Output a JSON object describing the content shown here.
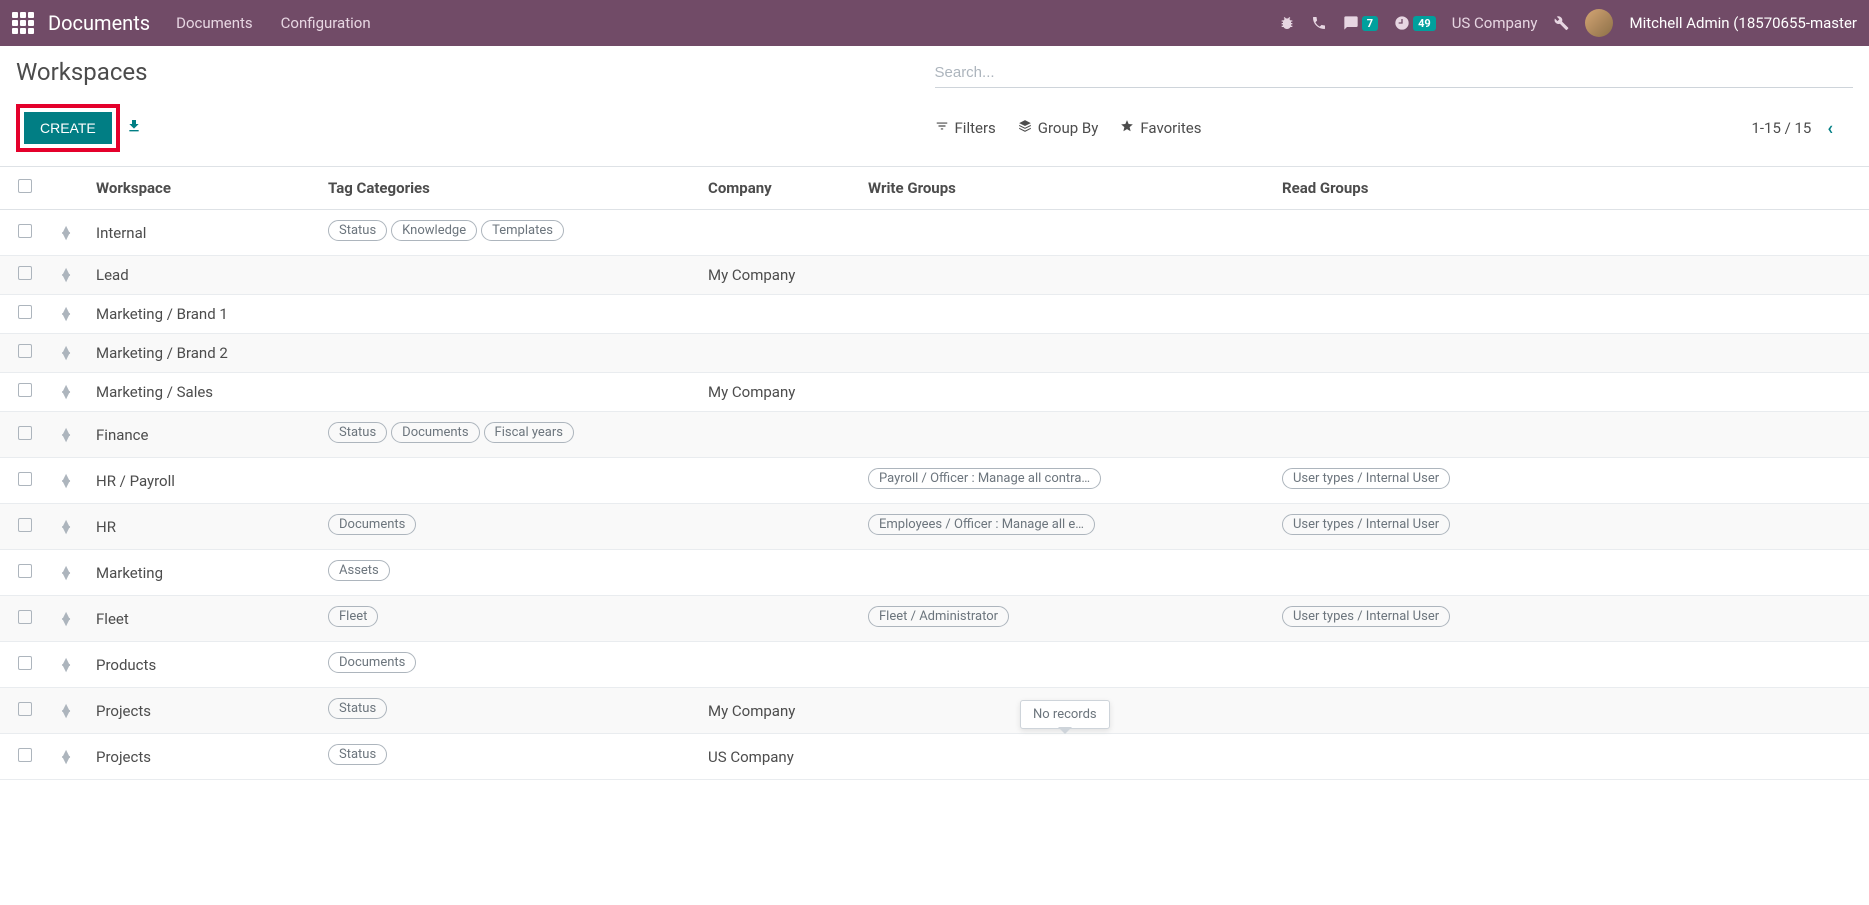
{
  "nav": {
    "app_title": "Documents",
    "links": [
      "Documents",
      "Configuration"
    ],
    "badges": {
      "messages": "7",
      "activities": "49"
    },
    "company": "US Company",
    "user": "Mitchell Admin (18570655-master"
  },
  "page": {
    "title": "Workspaces",
    "search_placeholder": "Search...",
    "create_label": "CREATE",
    "filters_label": "Filters",
    "groupby_label": "Group By",
    "favorites_label": "Favorites",
    "pager": "1-15 / 15"
  },
  "columns": {
    "workspace": "Workspace",
    "tags": "Tag Categories",
    "company": "Company",
    "write": "Write Groups",
    "read": "Read Groups"
  },
  "rows": [
    {
      "workspace": "Internal",
      "tags": [
        "Status",
        "Knowledge",
        "Templates"
      ],
      "company": "",
      "write": [],
      "read": []
    },
    {
      "workspace": "Lead",
      "tags": [],
      "company": "My Company",
      "write": [],
      "read": []
    },
    {
      "workspace": "Marketing / Brand 1",
      "tags": [],
      "company": "",
      "write": [],
      "read": []
    },
    {
      "workspace": "Marketing / Brand 2",
      "tags": [],
      "company": "",
      "write": [],
      "read": []
    },
    {
      "workspace": "Marketing / Sales",
      "tags": [],
      "company": "My Company",
      "write": [],
      "read": []
    },
    {
      "workspace": "Finance",
      "tags": [
        "Status",
        "Documents",
        "Fiscal years"
      ],
      "company": "",
      "write": [],
      "read": []
    },
    {
      "workspace": "HR / Payroll",
      "tags": [],
      "company": "",
      "write": [
        "Payroll / Officer : Manage all contra…"
      ],
      "read": [
        "User types / Internal User"
      ]
    },
    {
      "workspace": "HR",
      "tags": [
        "Documents"
      ],
      "company": "",
      "write": [
        "Employees / Officer : Manage all e…"
      ],
      "read": [
        "User types / Internal User"
      ]
    },
    {
      "workspace": "Marketing",
      "tags": [
        "Assets"
      ],
      "company": "",
      "write": [],
      "read": []
    },
    {
      "workspace": "Fleet",
      "tags": [
        "Fleet"
      ],
      "company": "",
      "write": [
        "Fleet / Administrator"
      ],
      "read": [
        "User types / Internal User"
      ]
    },
    {
      "workspace": "Products",
      "tags": [
        "Documents"
      ],
      "company": "",
      "write": [],
      "read": []
    },
    {
      "workspace": "Projects",
      "tags": [
        "Status"
      ],
      "company": "My Company",
      "write": [],
      "read": []
    },
    {
      "workspace": "Projects",
      "tags": [
        "Status"
      ],
      "company": "US Company",
      "write": [],
      "read": []
    }
  ],
  "tooltip": "No records"
}
